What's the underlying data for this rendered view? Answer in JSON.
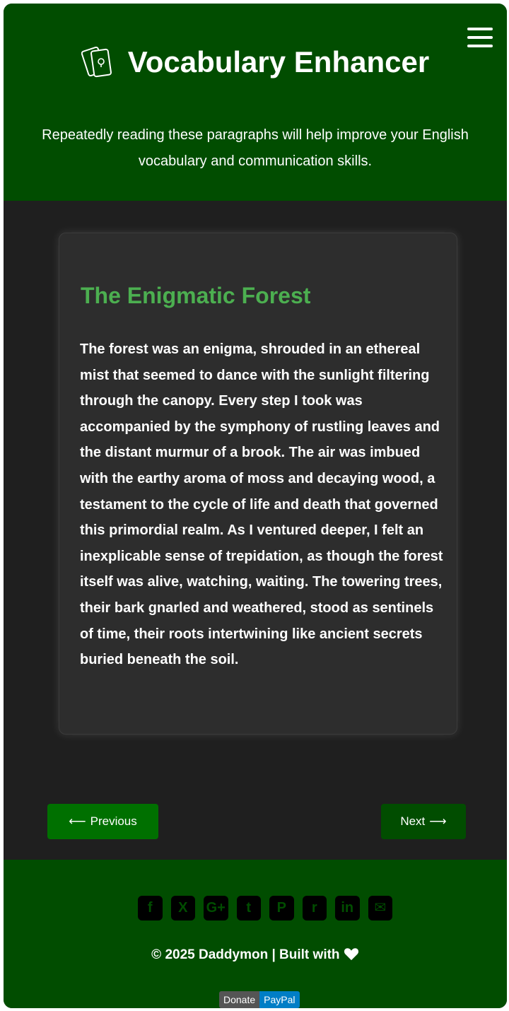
{
  "header": {
    "title": "Vocabulary Enhancer",
    "tagline": "Repeatedly reading these paragraphs will help improve your English vocabulary and communication skills.",
    "menu_icon": "hamburger-icon",
    "logo_icon": "flashcards-icon"
  },
  "card": {
    "title": "The Enigmatic Forest",
    "body": "The forest was an enigma, shrouded in an ethereal mist that seemed to dance with the sunlight filtering through the canopy. Every step I took was accompanied by the symphony of rustling leaves and the distant murmur of a brook. The air was imbued with the earthy aroma of moss and decaying wood, a testament to the cycle of life and death that governed this primordial realm. As I ventured deeper, I felt an inexplicable sense of trepidation, as though the forest itself was alive, watching, waiting. The towering trees, their bark gnarled and weathered, stood as sentinels of time, their roots intertwining like ancient secrets buried beneath the soil."
  },
  "nav": {
    "previous_label": "Previous",
    "previous_icon": "arrow-left-icon",
    "next_label": "Next",
    "next_icon": "arrow-right-icon"
  },
  "footer": {
    "socials": [
      {
        "name": "facebook-icon",
        "glyph": "f"
      },
      {
        "name": "x-icon",
        "glyph": "X"
      },
      {
        "name": "google-plus-icon",
        "glyph": "G+"
      },
      {
        "name": "tumblr-icon",
        "glyph": "t"
      },
      {
        "name": "pinterest-icon",
        "glyph": "P"
      },
      {
        "name": "reddit-icon",
        "glyph": "r"
      },
      {
        "name": "linkedin-icon",
        "glyph": "in"
      },
      {
        "name": "email-icon",
        "glyph": "✉"
      }
    ],
    "copyright": "2025 Daddymon | Built with",
    "donate_left": "Donate",
    "donate_right": "PayPal"
  },
  "colors": {
    "header_green": "#014d00",
    "button_green": "#007000",
    "title_green": "#4caf50",
    "background_dark": "#1f1f1f",
    "card_bg": "#2d2d2d"
  }
}
